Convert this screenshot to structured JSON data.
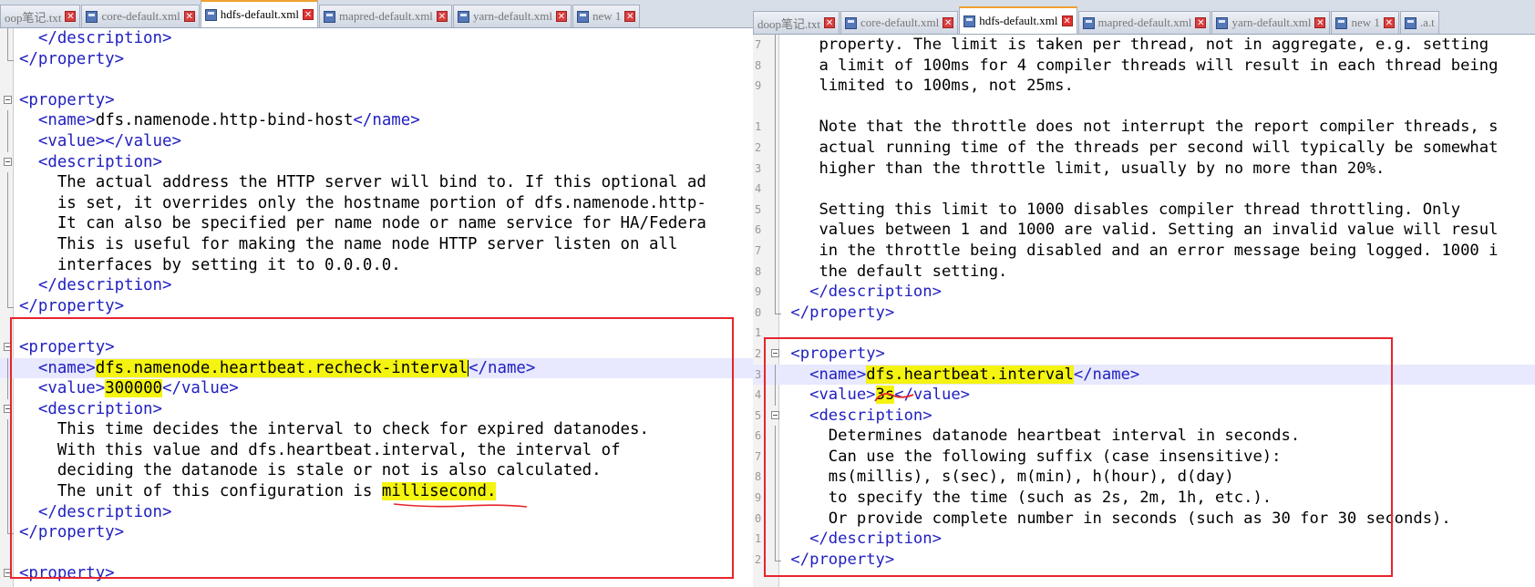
{
  "left_pane": {
    "tabs": [
      {
        "label": "oop笔记.txt",
        "active": false
      },
      {
        "label": "core-default.xml",
        "active": false
      },
      {
        "label": "hdfs-default.xml",
        "active": true
      },
      {
        "label": "mapred-default.xml",
        "active": false
      },
      {
        "label": "yarn-default.xml",
        "active": false
      },
      {
        "label": "new 1",
        "active": false
      }
    ],
    "lines": {
      "l1": "</description>",
      "l2": "</property>",
      "l4_open": "<property>",
      "l5_open": "<name>",
      "l5_text": "dfs.namenode.http-bind-host",
      "l5_close": "</name>",
      "l6": "<value></value>",
      "l7": "<description>",
      "l8": "The actual address the HTTP server will bind to. If this optional ad",
      "l9": "is set, it overrides only the hostname portion of dfs.namenode.http-",
      "l10": "It can also be specified per name node or name service for HA/Federa",
      "l11": "This is useful for making the name node HTTP server listen on all",
      "l12": "interfaces by setting it to 0.0.0.0.",
      "l13": "</description>",
      "l14": "</property>",
      "l16": "<property>",
      "l17_open": "<name>",
      "l17_text": "dfs.namenode.heartbeat.recheck-interval",
      "l17_close": "</name>",
      "l18_open": "<value>",
      "l18_text": "300000",
      "l18_close": "</value>",
      "l19": "<description>",
      "l20": "This time decides the interval to check for expired datanodes.",
      "l21": "With this value and dfs.heartbeat.interval, the interval of",
      "l22": "deciding the datanode is stale or not is also calculated.",
      "l23_pre": "The unit of this configuration is ",
      "l23_hl": "millisecond.",
      "l24": "</description>",
      "l25": "</property>",
      "l27": "<property>"
    }
  },
  "right_pane": {
    "tabs": [
      {
        "label": "doop笔记.txt",
        "active": false
      },
      {
        "label": "core-default.xml",
        "active": false
      },
      {
        "label": "hdfs-default.xml",
        "active": true
      },
      {
        "label": "mapred-default.xml",
        "active": false
      },
      {
        "label": "yarn-default.xml",
        "active": false
      },
      {
        "label": "new 1",
        "active": false
      },
      {
        "label": ".a.t",
        "active": false
      }
    ],
    "line_numbers": [
      "7",
      "8",
      "9",
      "",
      "1",
      "2",
      "3",
      "4",
      "5",
      "6",
      "7",
      "8",
      "9",
      "0",
      "1",
      "2",
      "3",
      "4",
      "5",
      "6",
      "7",
      "8",
      "9",
      "0",
      "1",
      "2",
      "3",
      "4",
      "5"
    ],
    "lines": {
      "r1": "property. The limit is taken per thread, not in aggregate, e.g. setting",
      "r2": "a limit of 100ms for 4 compiler threads will result in each thread being",
      "r3": "limited to 100ms, not 25ms.",
      "r5": "Note that the throttle does not interrupt the report compiler threads, s",
      "r6": "actual running time of the threads per second will typically be somewhat",
      "r7": "higher than the throttle limit, usually by no more than 20%.",
      "r9": "Setting this limit to 1000 disables compiler thread throttling. Only",
      "r10": "values between 1 and 1000 are valid. Setting an invalid value will resul",
      "r11": "in the throttle being disabled and an error message being logged. 1000 i",
      "r12": "the default setting.",
      "r13": "</description>",
      "r14": "</property>",
      "r16": "<property>",
      "r17_open": "<name>",
      "r17_text": "dfs.heartbeat.interval",
      "r17_close": "</name>",
      "r18_open": "<value>",
      "r18_text": "3s",
      "r18_close": "</value>",
      "r19": "<description>",
      "r20": "Determines datanode heartbeat interval in seconds.",
      "r21": "Can use the following suffix (case insensitive):",
      "r22": "ms(millis), s(sec), m(min), h(hour), d(day)",
      "r23": "to specify the time (such as 2s, 2m, 1h, etc.).",
      "r24": "Or provide complete number in seconds (such as 30 for 30 seconds).",
      "r25": "</description>",
      "r26": "</property>"
    }
  },
  "colors": {
    "tag": "#2020c0",
    "highlight": "#f4f410",
    "annotation_red": "#e8242c"
  }
}
